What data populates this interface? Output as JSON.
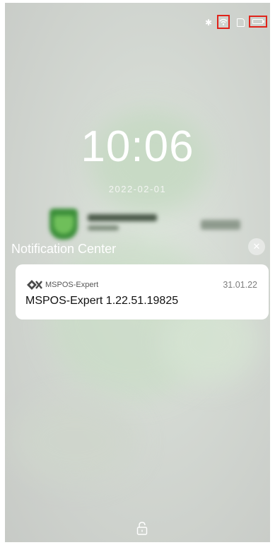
{
  "status_bar": {
    "icons": [
      "bluetooth-icon",
      "wifi-icon",
      "sim-icon",
      "battery-icon"
    ],
    "highlight_color": "#e0241b"
  },
  "lock_screen": {
    "time": "10:06",
    "date": "2022-02-01",
    "wallpaper_logo": "bank-logo",
    "lock_icon": "lock-icon"
  },
  "notification_center": {
    "title": "Notification Center",
    "close_icon": "close-icon",
    "notifications": [
      {
        "app_name": "MSPOS-Expert",
        "app_icon": "mspos-app-icon",
        "time": "31.01.22",
        "message": "MSPOS-Expert 1.22.51.19825"
      }
    ]
  },
  "colors": {
    "card_bg": "#ffffff",
    "text_primary": "#111111",
    "text_secondary": "#7d7d7d",
    "bank_green": "#3c8f3a"
  }
}
